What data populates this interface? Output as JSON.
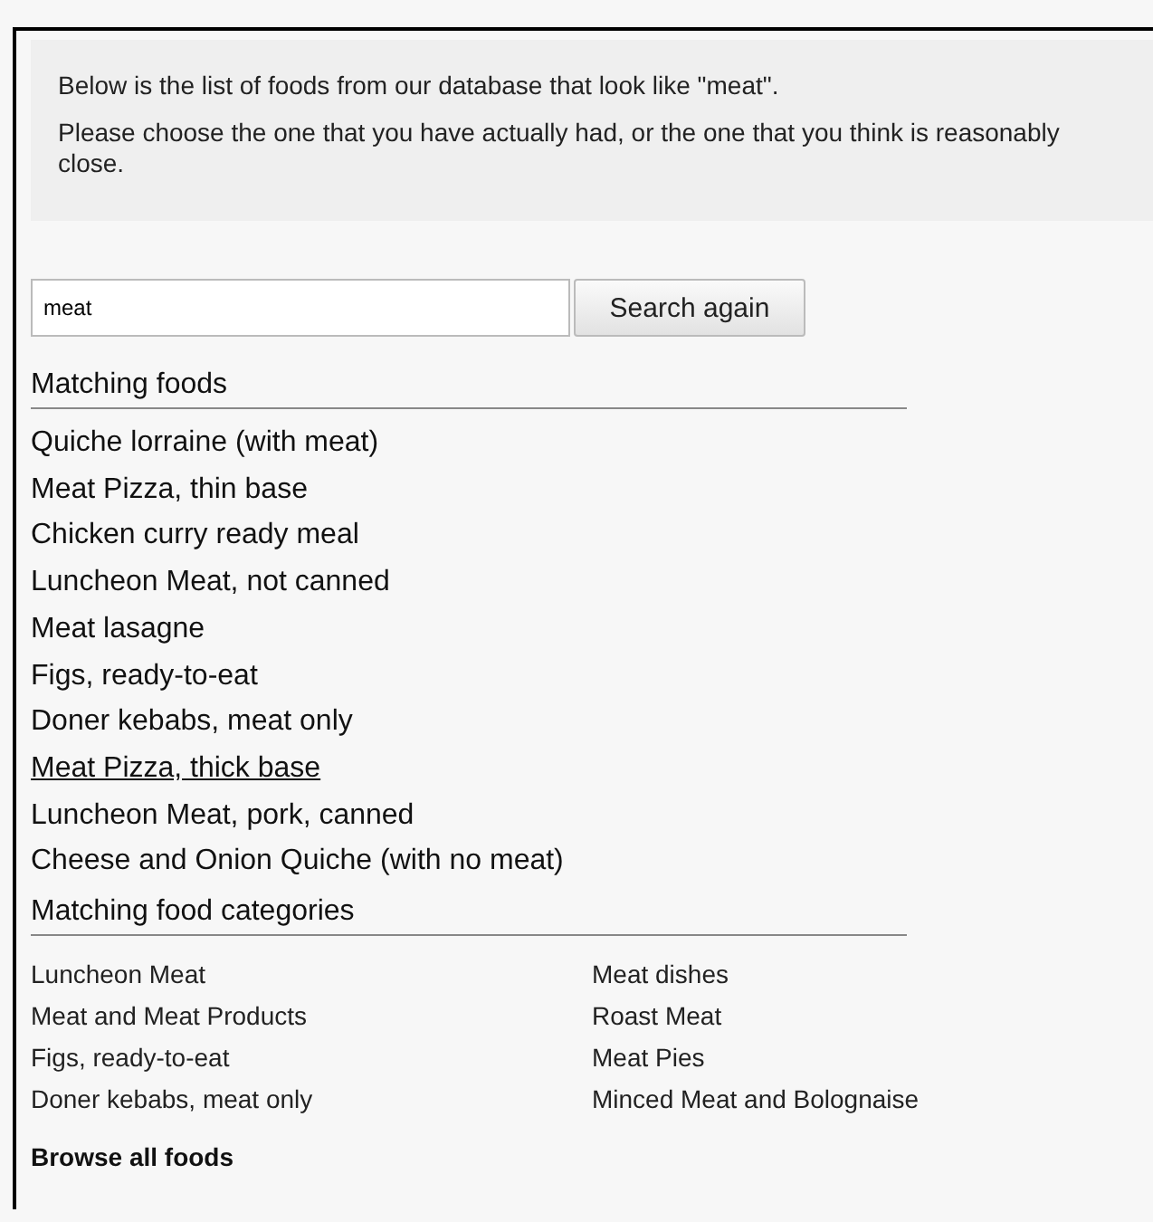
{
  "intro": [
    "Below is the list of foods from our database that look like \"meat\".",
    "Please choose the one that you have actually had, or the one that you think is reasonably close."
  ],
  "search": {
    "value": "meat",
    "button": "Search again"
  },
  "matching_foods": {
    "heading": "Matching foods",
    "items": [
      {
        "label": "Quiche lorraine (with meat)",
        "hovered": false
      },
      {
        "label": "Meat Pizza, thin base",
        "hovered": false
      },
      {
        "label": "Chicken curry ready meal",
        "hovered": false
      },
      {
        "label": "Luncheon Meat, not canned",
        "hovered": false
      },
      {
        "label": "Meat lasagne",
        "hovered": false
      },
      {
        "label": "Figs, ready-to-eat",
        "hovered": false
      },
      {
        "label": "Doner kebabs, meat only",
        "hovered": false
      },
      {
        "label": "Meat Pizza, thick base",
        "hovered": true
      },
      {
        "label": "Luncheon Meat, pork, canned",
        "hovered": false
      },
      {
        "label": "Cheese and Onion Quiche (with no meat)",
        "hovered": false
      }
    ]
  },
  "matching_categories": {
    "heading": "Matching food categories",
    "items": [
      "Luncheon Meat",
      "Meat dishes",
      "Meat and Meat Products",
      "Roast Meat",
      "Figs, ready-to-eat",
      "Meat Pies",
      "Doner kebabs, meat only",
      "Minced Meat and Bolognaise"
    ]
  },
  "browse_link": "Browse all foods"
}
